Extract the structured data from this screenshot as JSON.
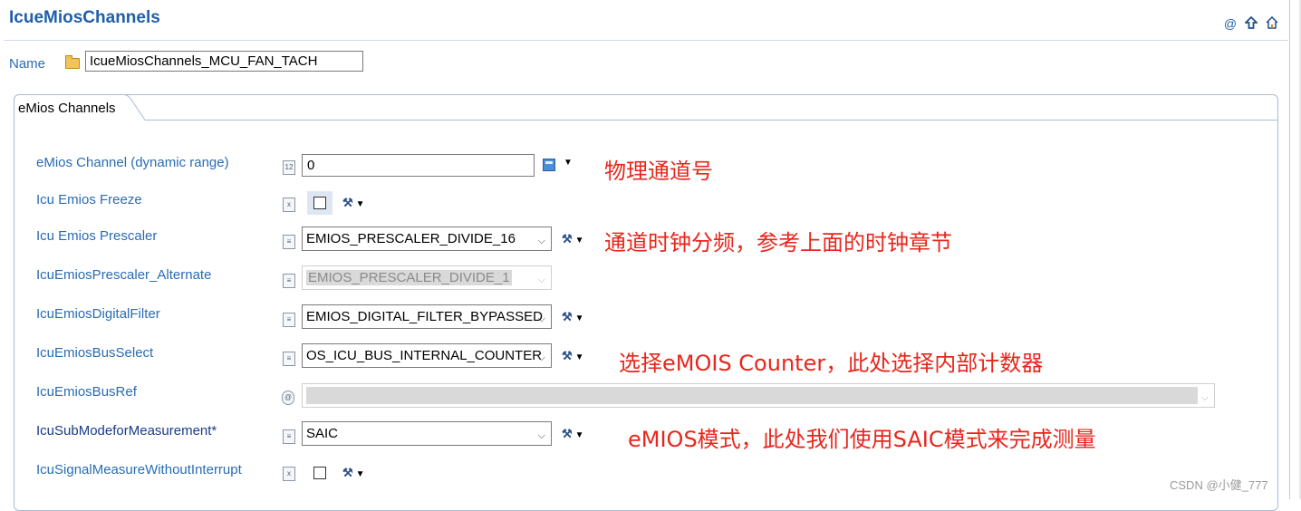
{
  "header": {
    "title": "IcueMiosChannels",
    "icons": [
      "at-icon",
      "up-arrow-icon",
      "home-icon"
    ]
  },
  "name_field": {
    "label": "Name",
    "value": "IcueMiosChannels_MCU_FAN_TACH"
  },
  "tab": {
    "label": "eMios Channels"
  },
  "fields": [
    {
      "label": "eMios Channel (dynamic range)",
      "type": "text",
      "value": "0"
    },
    {
      "label": "Icu Emios Freeze",
      "type": "checkbox",
      "checked": false
    },
    {
      "label": "Icu Emios Prescaler",
      "type": "select",
      "value": "EMIOS_PRESCALER_DIVIDE_16"
    },
    {
      "label": "IcuEmiosPrescaler_Alternate",
      "type": "select",
      "value": "EMIOS_PRESCALER_DIVIDE_1",
      "disabled": true
    },
    {
      "label": "IcuEmiosDigitalFilter",
      "type": "select",
      "value": "EMIOS_DIGITAL_FILTER_BYPASSED"
    },
    {
      "label": "IcuEmiosBusSelect",
      "type": "select",
      "value": "OS_ICU_BUS_INTERNAL_COUNTER"
    },
    {
      "label": "IcuEmiosBusRef",
      "type": "select",
      "value": "",
      "disabled": true
    },
    {
      "label": "IcuSubModeforMeasurement*",
      "type": "select",
      "value": "SAIC"
    },
    {
      "label": "IcuSignalMeasureWithoutInterrupt",
      "type": "checkbox",
      "checked": false
    }
  ],
  "annotations": [
    "物理通道号",
    "通道时钟分频，参考上面的时钟章节",
    "选择eMOIS Counter，此处选择内部计数器",
    "eMIOS模式，此处我们使用SAIC模式来完成测量"
  ],
  "watermark": "CSDN @小健_777",
  "colors": {
    "title": "#1f5fa8",
    "label": "#2a6cb3",
    "annotation": "#e8261c"
  }
}
